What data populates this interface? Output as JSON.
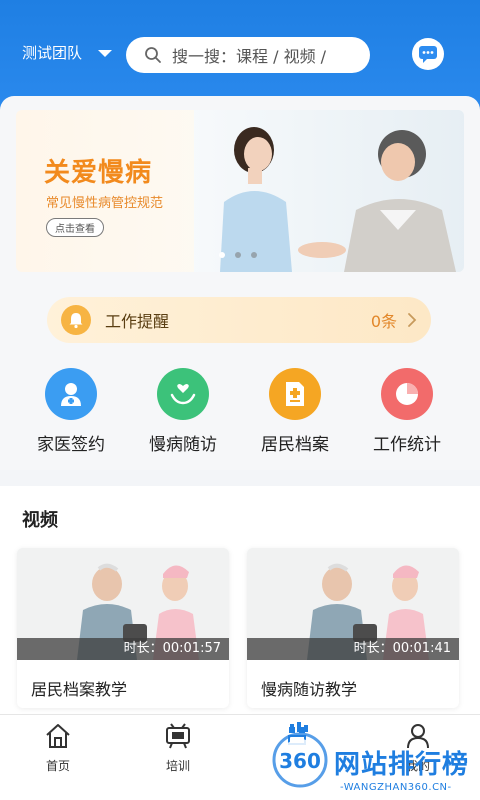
{
  "header": {
    "team_name": "测试团队",
    "search_placeholder": "搜一搜：课程 / 视频 /",
    "colors": {
      "primary": "#2d8cf0"
    }
  },
  "banner": {
    "title": "关爱慢病",
    "subtitle": "常见慢性病管控规范",
    "button": "点击查看",
    "slide_count": 3,
    "active_slide": 1
  },
  "reminder": {
    "label": "工作提醒",
    "count": "0条"
  },
  "quick_actions": [
    {
      "label": "家医签约",
      "icon": "doctor-icon",
      "color": "#3b9df2"
    },
    {
      "label": "慢病随访",
      "icon": "heart-hands-icon",
      "color": "#3cc27a"
    },
    {
      "label": "居民档案",
      "icon": "medical-file-icon",
      "color": "#f5a623"
    },
    {
      "label": "工作统计",
      "icon": "pie-chart-icon",
      "color": "#f26b6b"
    }
  ],
  "video_section": {
    "title": "视频",
    "items": [
      {
        "title": "居民档案教学",
        "duration": "时长：00:01:57"
      },
      {
        "title": "慢病随访教学",
        "duration": "时长：00:01:41"
      }
    ]
  },
  "tabbar": {
    "items": [
      {
        "label": "首页",
        "icon": "home-icon"
      },
      {
        "label": "培训",
        "icon": "training-icon"
      },
      {
        "label": "",
        "icon": "center-icon"
      },
      {
        "label": "我的",
        "icon": "profile-icon"
      }
    ]
  },
  "watermark": {
    "brand": "360",
    "text": "网站排行榜",
    "url": "-WANGZHAN360.CN-"
  }
}
